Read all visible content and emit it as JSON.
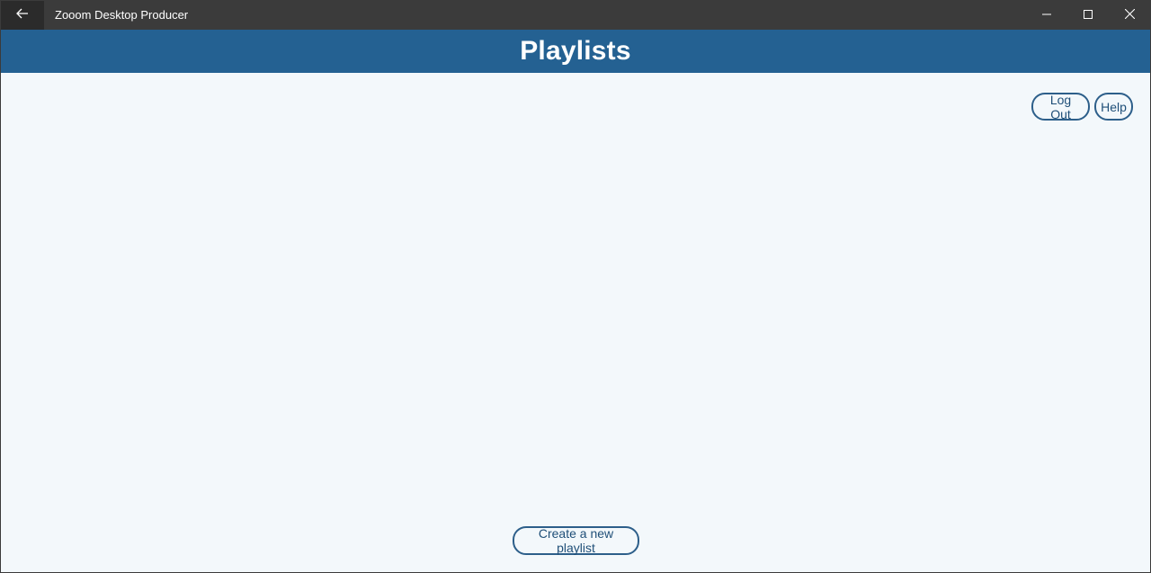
{
  "titlebar": {
    "app_title": "Zooom Desktop Producer",
    "back_icon": "arrow-left-icon",
    "minimize_icon": "minimize-icon",
    "maximize_icon": "maximize-icon",
    "close_icon": "close-icon"
  },
  "header": {
    "title": "Playlists",
    "color": "#246192"
  },
  "actions": {
    "logout_label": "Log Out",
    "help_label": "Help",
    "create_playlist_label": "Create a new playlist"
  }
}
